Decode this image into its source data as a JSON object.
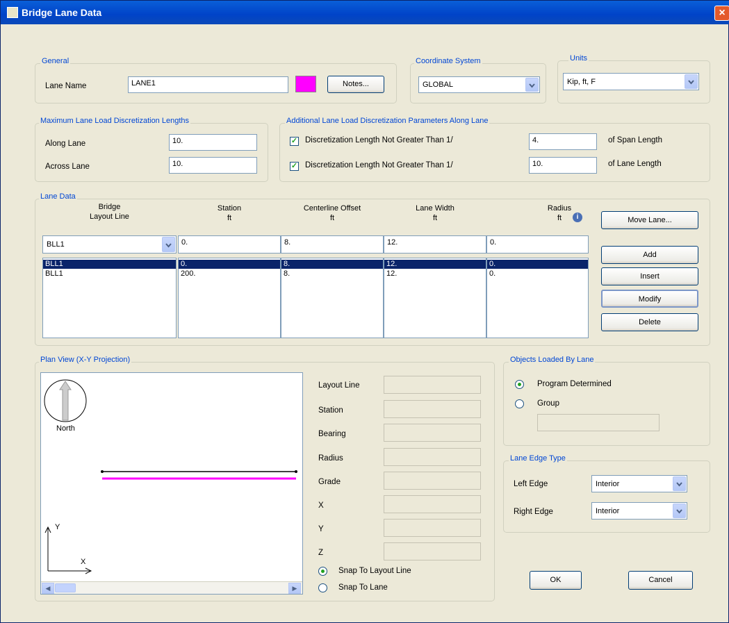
{
  "window": {
    "title": "Bridge Lane Data",
    "close_glyph": "×"
  },
  "general": {
    "group_label": "General",
    "lane_name_label": "Lane Name",
    "lane_name_value": "LANE1",
    "color": "#ff00ff",
    "notes_button": "Notes..."
  },
  "coordinate_system": {
    "group_label": "Coordinate System",
    "value": "GLOBAL"
  },
  "units": {
    "group_label": "Units",
    "value": "Kip, ft, F"
  },
  "max_disc": {
    "group_label": "Maximum Lane Load Discretization Lengths",
    "along_label": "Along Lane",
    "along_value": "10.",
    "across_label": "Across Lane",
    "across_value": "10."
  },
  "add_disc": {
    "group_label": "Additional Lane Load Discretization Parameters Along Lane",
    "row1_label": "Discretization Length Not Greater Than  1/",
    "row1_value": "4.",
    "row1_suffix": "of Span Length",
    "row2_label": "Discretization Length Not Greater Than  1/",
    "row2_value": "10.",
    "row2_suffix": "of Lane Length"
  },
  "lane_data": {
    "group_label": "Lane Data",
    "headers": {
      "layout_line": [
        "Bridge",
        "Layout Line"
      ],
      "station": [
        "Station",
        "ft"
      ],
      "offset": [
        "Centerline Offset",
        "ft"
      ],
      "width": [
        "Lane Width",
        "ft"
      ],
      "radius": [
        "Radius",
        "ft"
      ]
    },
    "edit_row": {
      "layout_line": "BLL1",
      "station": "0.",
      "offset": "8.",
      "width": "12.",
      "radius": "0."
    },
    "rows": [
      {
        "layout_line": "BLL1",
        "station": "0.",
        "offset": "8.",
        "width": "12.",
        "radius": "0."
      },
      {
        "layout_line": "BLL1",
        "station": "200.",
        "offset": "8.",
        "width": "12.",
        "radius": "0."
      }
    ],
    "info_glyph": "i",
    "buttons": {
      "move": "Move Lane...",
      "add": "Add",
      "insert": "Insert",
      "modify": "Modify",
      "delete": "Delete"
    }
  },
  "plan_view": {
    "group_label": "Plan View (X-Y Projection)",
    "north_label": "North",
    "axis_x": "X",
    "axis_y": "Y",
    "fields": {
      "layout_line": "Layout Line",
      "station": "Station",
      "bearing": "Bearing",
      "radius": "Radius",
      "grade": "Grade",
      "x": "X",
      "y": "Y",
      "z": "Z"
    },
    "snap_layout": "Snap To Layout Line",
    "snap_lane": "Snap To Lane"
  },
  "objects_loaded": {
    "group_label": "Objects Loaded By Lane",
    "program": "Program Determined",
    "group": "Group"
  },
  "edge_type": {
    "group_label": "Lane Edge Type",
    "left_label": "Left Edge",
    "left_value": "Interior",
    "right_label": "Right Edge",
    "right_value": "Interior"
  },
  "footer": {
    "ok": "OK",
    "cancel": "Cancel"
  }
}
